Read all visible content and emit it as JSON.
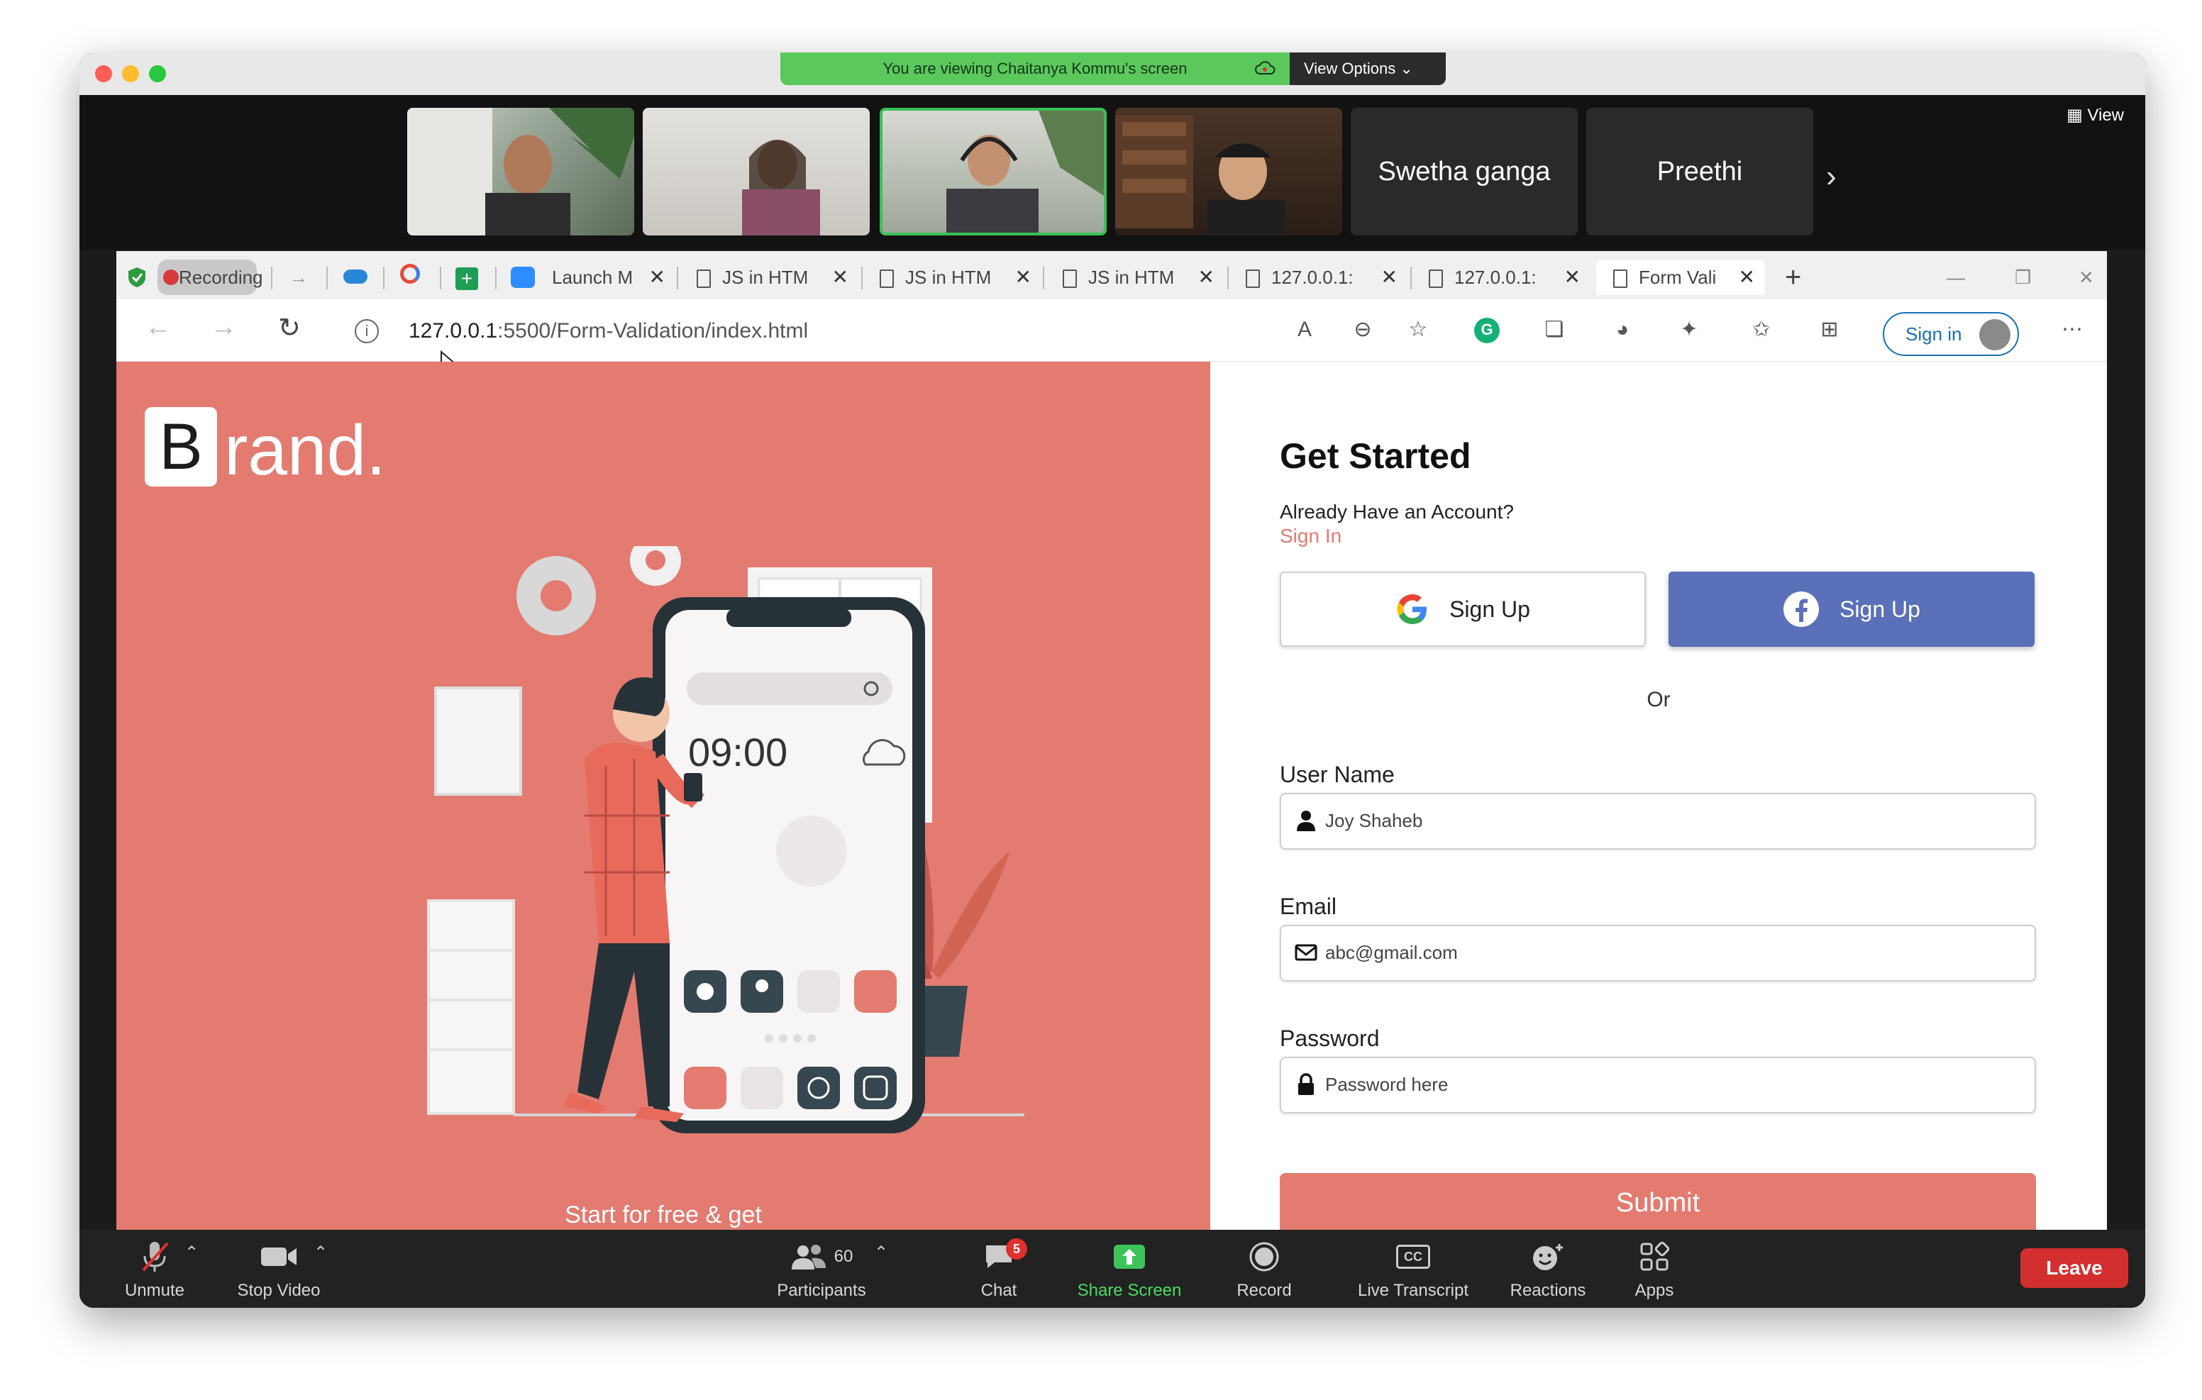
{
  "window": {
    "viewing_banner": "You are viewing Chaitanya Kommu's screen",
    "view_options_label": "View Options",
    "view_label": "View"
  },
  "participants": {
    "tiles": [
      {
        "name": "Swetha ganga"
      },
      {
        "name": "Preethi"
      }
    ]
  },
  "browser": {
    "tabs": [
      {
        "label": "Recording"
      },
      {
        "label": "Launch M"
      },
      {
        "label": "JS in HTM"
      },
      {
        "label": "JS in HTM"
      },
      {
        "label": "JS in HTM"
      },
      {
        "label": "127.0.0.1:"
      },
      {
        "label": "127.0.0.1:"
      },
      {
        "label": "Form Vali"
      }
    ],
    "url_host": "127.0.0.1",
    "url_path": ":5500/Form-Validation/index.html",
    "signin_label": "Sign in"
  },
  "page": {
    "brand_letter": "B",
    "brand_rest": "rand.",
    "phone_time": "09:00",
    "tagline": "Start for free & get",
    "heading": "Get Started",
    "already": "Already Have an Account?",
    "signin_link": "Sign In",
    "google_btn": "Sign Up",
    "facebook_btn": "Sign Up",
    "or": "Or",
    "username_label": "User Name",
    "username_placeholder": "Joy Shaheb",
    "email_label": "Email",
    "email_placeholder": "abc@gmail.com",
    "password_label": "Password",
    "password_placeholder": "Password here",
    "submit": "Submit"
  },
  "zoom": {
    "unmute": "Unmute",
    "stop_video": "Stop Video",
    "participants": "Participants",
    "participants_count": "60",
    "chat": "Chat",
    "chat_badge": "5",
    "share_screen": "Share Screen",
    "record": "Record",
    "live_transcript": "Live Transcript",
    "cc": "CC",
    "reactions": "Reactions",
    "apps": "Apps",
    "leave": "Leave"
  },
  "colors": {
    "brand_coral": "#e37b70",
    "facebook_blue": "#5a70b8",
    "zoom_green": "#5bc85d",
    "leave_red": "#d32f2f"
  }
}
